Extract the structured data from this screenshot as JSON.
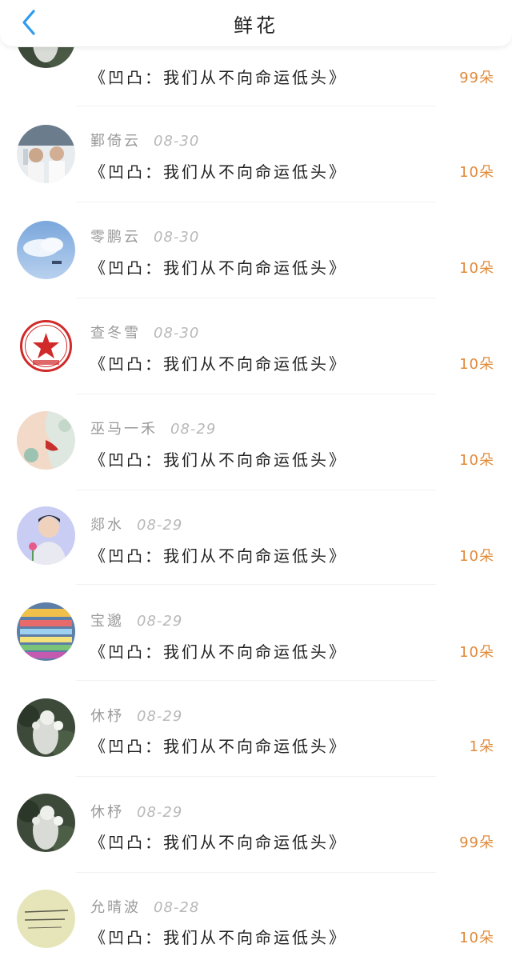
{
  "header": {
    "title": "鲜花",
    "back_icon": "chevron-left-icon",
    "accent": "#2d9cf0"
  },
  "colors": {
    "count": "#e08a3a",
    "name": "#9a9a9a",
    "text": "#222222"
  },
  "items": [
    {
      "name": "",
      "date": "",
      "book": "《凹凸：我们从不向命运低头》",
      "count": "99朵",
      "avatar": "statue-bubbles"
    },
    {
      "name": "鄞倚云",
      "date": "08-30",
      "book": "《凹凸：我们从不向命运低头》",
      "count": "10朵",
      "avatar": "couple-photo"
    },
    {
      "name": "零鹏云",
      "date": "08-30",
      "book": "《凹凸：我们从不向命运低头》",
      "count": "10朵",
      "avatar": "blue-sky"
    },
    {
      "name": "查冬雪",
      "date": "08-30",
      "book": "《凹凸：我们从不向命运低头》",
      "count": "10朵",
      "avatar": "red-seal"
    },
    {
      "name": "巫马一禾",
      "date": "08-29",
      "book": "《凹凸：我们从不向命运低头》",
      "count": "10朵",
      "avatar": "lips-art"
    },
    {
      "name": "郯水",
      "date": "08-29",
      "book": "《凹凸：我们从不向命运低头》",
      "count": "10朵",
      "avatar": "man-with-rose"
    },
    {
      "name": "宝邈",
      "date": "08-29",
      "book": "《凹凸：我们从不向命运低头》",
      "count": "10朵",
      "avatar": "game-screenshot"
    },
    {
      "name": "休杼",
      "date": "08-29",
      "book": "《凹凸：我们从不向命运低头》",
      "count": "1朵",
      "avatar": "statue-bubbles"
    },
    {
      "name": "休杼",
      "date": "08-29",
      "book": "《凹凸：我们从不向命运低头》",
      "count": "99朵",
      "avatar": "statue-bubbles"
    },
    {
      "name": "允晴波",
      "date": "08-28",
      "book": "《凹凸：我们从不向命运低头》",
      "count": "10朵",
      "avatar": "handwriting-note"
    }
  ]
}
